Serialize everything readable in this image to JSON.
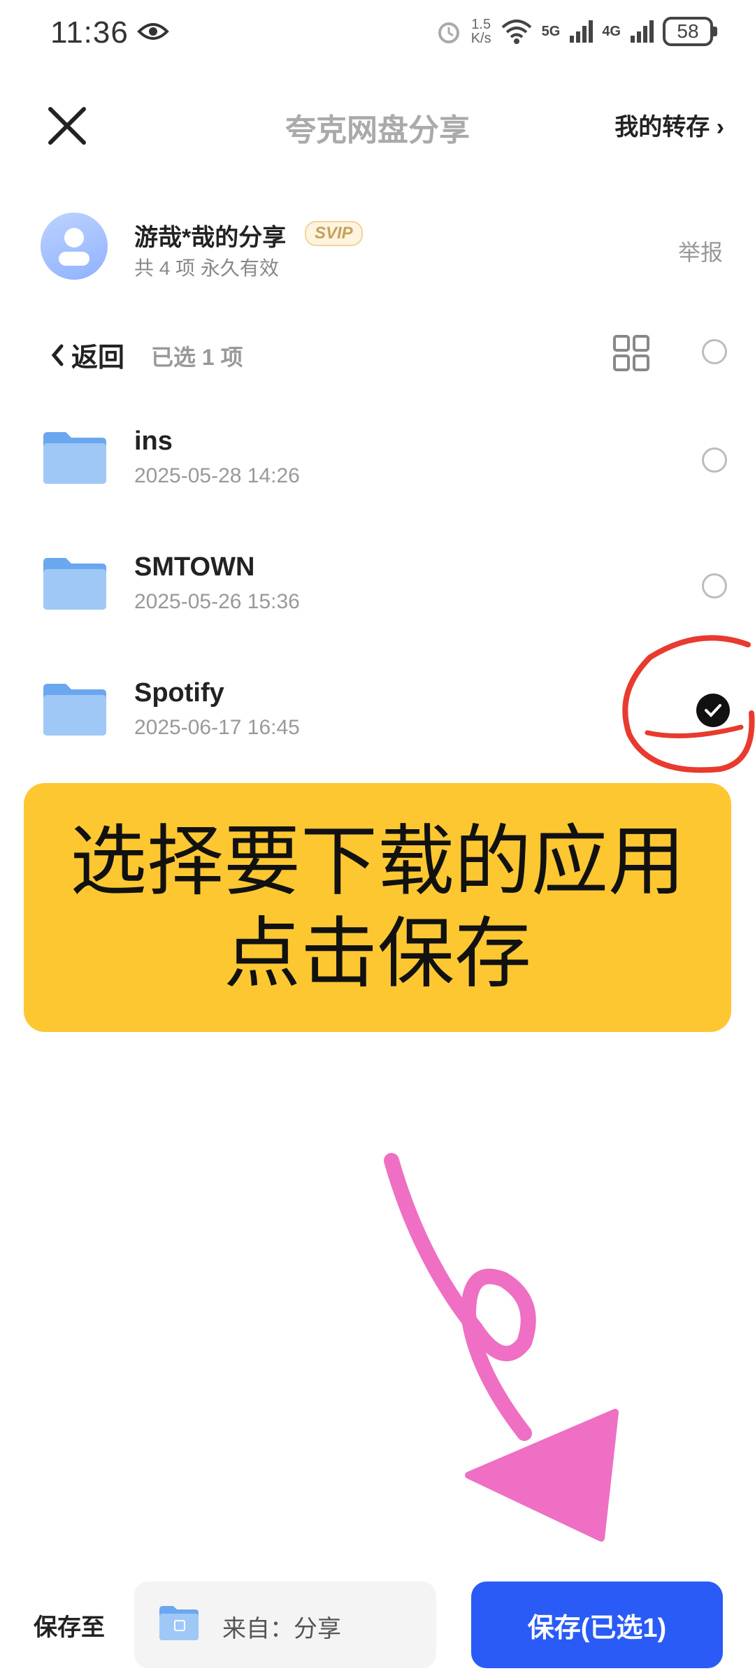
{
  "status_bar": {
    "time": "11:36",
    "net_speed_value": "1.5",
    "net_speed_unit": "K/s",
    "battery": "58",
    "signal_5g": "5G",
    "signal_4g": "4G"
  },
  "header": {
    "title": "夸克网盘分享",
    "my_transfer": "我的转存 ›"
  },
  "share": {
    "sharer": "游哉*哉的分享",
    "badge": "SVIP",
    "meta": "共 4 项   永久有效",
    "report": "举报"
  },
  "toolbar": {
    "back": "返回",
    "selected": "已选 1 项"
  },
  "files": [
    {
      "name": "ins",
      "date": "2025-05-28 14:26",
      "selected": false
    },
    {
      "name": "SMTOWN",
      "date": "2025-05-26 15:36",
      "selected": false
    },
    {
      "name": "Spotify",
      "date": "2025-06-17 16:45",
      "selected": true
    }
  ],
  "banner": {
    "line1": "选择要下载的应用",
    "line2": "点击保存"
  },
  "bottom": {
    "save_to": "保存至",
    "destination": "来自：分享",
    "save_button": "保存(已选1)"
  },
  "colors": {
    "accent_blue": "#2a5bf6",
    "banner_yellow": "#fdc732",
    "annotation_red": "#e83a2f",
    "annotation_pink": "#ee6fc4",
    "folder_blue": "#7fb6f5"
  },
  "icons": [
    "eye-icon",
    "alarm-icon",
    "wifi-icon",
    "signal-icon",
    "battery-icon",
    "close-icon",
    "grid-view-icon",
    "chevron-left-icon",
    "folder-icon",
    "check-icon"
  ]
}
